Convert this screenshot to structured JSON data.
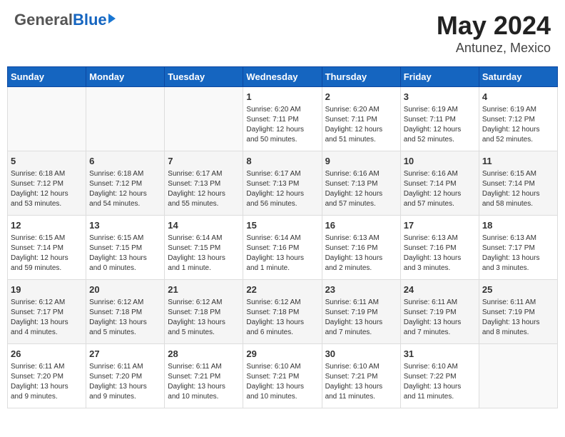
{
  "logo": {
    "general": "General",
    "blue": "Blue"
  },
  "title": {
    "month_year": "May 2024",
    "location": "Antunez, Mexico"
  },
  "header_days": [
    "Sunday",
    "Monday",
    "Tuesday",
    "Wednesday",
    "Thursday",
    "Friday",
    "Saturday"
  ],
  "weeks": [
    [
      {
        "day": "",
        "info": ""
      },
      {
        "day": "",
        "info": ""
      },
      {
        "day": "",
        "info": ""
      },
      {
        "day": "1",
        "info": "Sunrise: 6:20 AM\nSunset: 7:11 PM\nDaylight: 12 hours\nand 50 minutes."
      },
      {
        "day": "2",
        "info": "Sunrise: 6:20 AM\nSunset: 7:11 PM\nDaylight: 12 hours\nand 51 minutes."
      },
      {
        "day": "3",
        "info": "Sunrise: 6:19 AM\nSunset: 7:11 PM\nDaylight: 12 hours\nand 52 minutes."
      },
      {
        "day": "4",
        "info": "Sunrise: 6:19 AM\nSunset: 7:12 PM\nDaylight: 12 hours\nand 52 minutes."
      }
    ],
    [
      {
        "day": "5",
        "info": "Sunrise: 6:18 AM\nSunset: 7:12 PM\nDaylight: 12 hours\nand 53 minutes."
      },
      {
        "day": "6",
        "info": "Sunrise: 6:18 AM\nSunset: 7:12 PM\nDaylight: 12 hours\nand 54 minutes."
      },
      {
        "day": "7",
        "info": "Sunrise: 6:17 AM\nSunset: 7:13 PM\nDaylight: 12 hours\nand 55 minutes."
      },
      {
        "day": "8",
        "info": "Sunrise: 6:17 AM\nSunset: 7:13 PM\nDaylight: 12 hours\nand 56 minutes."
      },
      {
        "day": "9",
        "info": "Sunrise: 6:16 AM\nSunset: 7:13 PM\nDaylight: 12 hours\nand 57 minutes."
      },
      {
        "day": "10",
        "info": "Sunrise: 6:16 AM\nSunset: 7:14 PM\nDaylight: 12 hours\nand 57 minutes."
      },
      {
        "day": "11",
        "info": "Sunrise: 6:15 AM\nSunset: 7:14 PM\nDaylight: 12 hours\nand 58 minutes."
      }
    ],
    [
      {
        "day": "12",
        "info": "Sunrise: 6:15 AM\nSunset: 7:14 PM\nDaylight: 12 hours\nand 59 minutes."
      },
      {
        "day": "13",
        "info": "Sunrise: 6:15 AM\nSunset: 7:15 PM\nDaylight: 13 hours\nand 0 minutes."
      },
      {
        "day": "14",
        "info": "Sunrise: 6:14 AM\nSunset: 7:15 PM\nDaylight: 13 hours\nand 1 minute."
      },
      {
        "day": "15",
        "info": "Sunrise: 6:14 AM\nSunset: 7:16 PM\nDaylight: 13 hours\nand 1 minute."
      },
      {
        "day": "16",
        "info": "Sunrise: 6:13 AM\nSunset: 7:16 PM\nDaylight: 13 hours\nand 2 minutes."
      },
      {
        "day": "17",
        "info": "Sunrise: 6:13 AM\nSunset: 7:16 PM\nDaylight: 13 hours\nand 3 minutes."
      },
      {
        "day": "18",
        "info": "Sunrise: 6:13 AM\nSunset: 7:17 PM\nDaylight: 13 hours\nand 3 minutes."
      }
    ],
    [
      {
        "day": "19",
        "info": "Sunrise: 6:12 AM\nSunset: 7:17 PM\nDaylight: 13 hours\nand 4 minutes."
      },
      {
        "day": "20",
        "info": "Sunrise: 6:12 AM\nSunset: 7:18 PM\nDaylight: 13 hours\nand 5 minutes."
      },
      {
        "day": "21",
        "info": "Sunrise: 6:12 AM\nSunset: 7:18 PM\nDaylight: 13 hours\nand 5 minutes."
      },
      {
        "day": "22",
        "info": "Sunrise: 6:12 AM\nSunset: 7:18 PM\nDaylight: 13 hours\nand 6 minutes."
      },
      {
        "day": "23",
        "info": "Sunrise: 6:11 AM\nSunset: 7:19 PM\nDaylight: 13 hours\nand 7 minutes."
      },
      {
        "day": "24",
        "info": "Sunrise: 6:11 AM\nSunset: 7:19 PM\nDaylight: 13 hours\nand 7 minutes."
      },
      {
        "day": "25",
        "info": "Sunrise: 6:11 AM\nSunset: 7:19 PM\nDaylight: 13 hours\nand 8 minutes."
      }
    ],
    [
      {
        "day": "26",
        "info": "Sunrise: 6:11 AM\nSunset: 7:20 PM\nDaylight: 13 hours\nand 9 minutes."
      },
      {
        "day": "27",
        "info": "Sunrise: 6:11 AM\nSunset: 7:20 PM\nDaylight: 13 hours\nand 9 minutes."
      },
      {
        "day": "28",
        "info": "Sunrise: 6:11 AM\nSunset: 7:21 PM\nDaylight: 13 hours\nand 10 minutes."
      },
      {
        "day": "29",
        "info": "Sunrise: 6:10 AM\nSunset: 7:21 PM\nDaylight: 13 hours\nand 10 minutes."
      },
      {
        "day": "30",
        "info": "Sunrise: 6:10 AM\nSunset: 7:21 PM\nDaylight: 13 hours\nand 11 minutes."
      },
      {
        "day": "31",
        "info": "Sunrise: 6:10 AM\nSunset: 7:22 PM\nDaylight: 13 hours\nand 11 minutes."
      },
      {
        "day": "",
        "info": ""
      }
    ]
  ]
}
